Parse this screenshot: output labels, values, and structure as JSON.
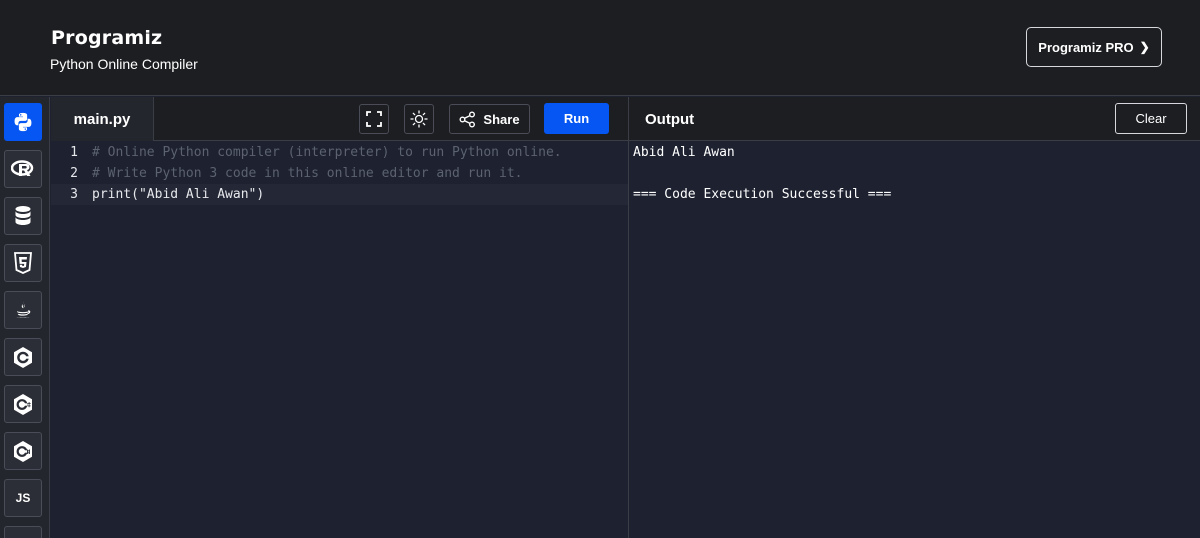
{
  "header": {
    "brand": "Programiz",
    "subtitle": "Python Online Compiler",
    "pro_button_label": "Programiz PRO"
  },
  "sidebar": {
    "items": [
      {
        "icon": "python-icon",
        "active": true
      },
      {
        "icon": "r-lang-icon",
        "active": false
      },
      {
        "icon": "database-icon",
        "active": false
      },
      {
        "icon": "html5-icon",
        "active": false
      },
      {
        "icon": "java-icon",
        "active": false
      },
      {
        "icon": "c-lang-icon",
        "active": false
      },
      {
        "icon": "cpp-lang-icon",
        "active": false
      },
      {
        "icon": "csharp-lang-icon",
        "active": false
      },
      {
        "icon": "js-icon",
        "label": "JS",
        "active": false
      }
    ]
  },
  "editor": {
    "file_tab": "main.py",
    "share_label": "Share",
    "run_label": "Run",
    "lines": [
      {
        "num": "1",
        "text": "# Online Python compiler (interpreter) to run Python online."
      },
      {
        "num": "2",
        "text": "# Write Python 3 code in this online editor and run it."
      },
      {
        "num": "3",
        "text": "print(\"Abid Ali Awan\")"
      }
    ]
  },
  "output": {
    "title": "Output",
    "clear_label": "Clear",
    "lines": [
      "Abid Ali Awan",
      "",
      "=== Code Execution Successful ==="
    ]
  },
  "colors": {
    "accent": "#0556f3",
    "header_bg": "#1d1e22",
    "editor_bg": "#1d2130",
    "comment": "#5c6270"
  }
}
